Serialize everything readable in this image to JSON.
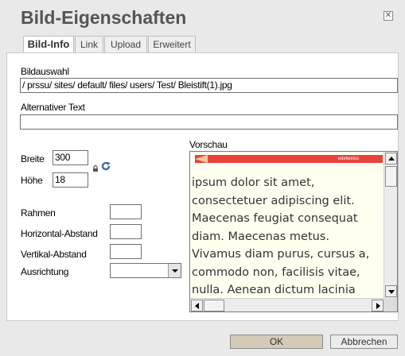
{
  "dialog": {
    "title": "Bild-Eigenschaften",
    "close_symbol": "☒"
  },
  "tabs": [
    {
      "label": "Bild-Info",
      "active": true
    },
    {
      "label": "Link",
      "active": false
    },
    {
      "label": "Upload",
      "active": false
    },
    {
      "label": "Erweitert",
      "active": false
    }
  ],
  "form": {
    "bildauswahl_label": "Bildauswahl",
    "bildauswahl_value": "/ prssu/ sites/ default/ files/ users/ Test/ Bleistift(1).jpg",
    "alttext_label": "Alternativer Text",
    "alttext_value": "",
    "breite_label": "Breite",
    "breite_value": "300",
    "hoehe_label": "Höhe",
    "hoehe_value": "18",
    "rahmen_label": "Rahmen",
    "rahmen_value": "",
    "hspace_label": "Horizontal-Abstand",
    "hspace_value": "",
    "vspace_label": "Vertikal-Abstand",
    "vspace_value": "",
    "align_label": "Ausrichtung",
    "align_value": ""
  },
  "preview": {
    "label": "Vorschau",
    "image_caption": "edelweiss",
    "text": "ipsum dolor sit amet, consectetuer adipiscing elit. Maecenas feugiat consequat diam. Maecenas metus. Vivamus diam purus, cursus a, commodo non, facilisis vitae, nulla. Aenean dictum lacinia"
  },
  "icons": {
    "lock": "lock-icon",
    "reset": "reset-size-icon"
  },
  "buttons": {
    "ok": "OK",
    "cancel": "Abbrechen"
  },
  "colors": {
    "ok_button": "#d3cab8",
    "pencil_red": "#e8423b",
    "preview_background": "#fffff0",
    "reset_icon": "#3a6ea5"
  }
}
